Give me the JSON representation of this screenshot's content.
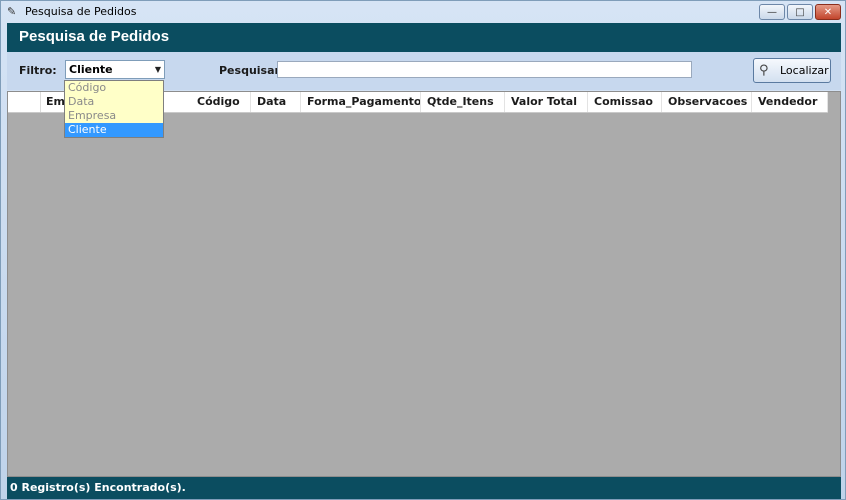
{
  "window": {
    "title": "Pesquisa de Pedidos",
    "minimize_glyph": "—",
    "maximize_glyph": "□",
    "close_glyph": "✕"
  },
  "header": {
    "title": "Pesquisa de Pedidos"
  },
  "filter": {
    "label": "Filtro:",
    "selected": "Cliente",
    "options": [
      "Código",
      "Data",
      "Empresa",
      "Cliente"
    ]
  },
  "search": {
    "label": "Pesquisar:",
    "value": "",
    "placeholder": ""
  },
  "localizar_button": {
    "label": "Localizar",
    "icon": "binoculars-icon"
  },
  "grid": {
    "columns": [
      "",
      "Empresa",
      "Código",
      "Data",
      "Forma_Pagamento",
      "Qtde_Itens",
      "Valor Total",
      "Comissao",
      "Observacoes",
      "Vendedor"
    ],
    "rows": []
  },
  "status": {
    "text": "0 Registro(s) Encontrado(s)."
  },
  "colors": {
    "header_band": "#0b4d60",
    "grid_background": "#ababab",
    "dropdown_background": "#ffffc8",
    "selection": "#3399ff"
  }
}
